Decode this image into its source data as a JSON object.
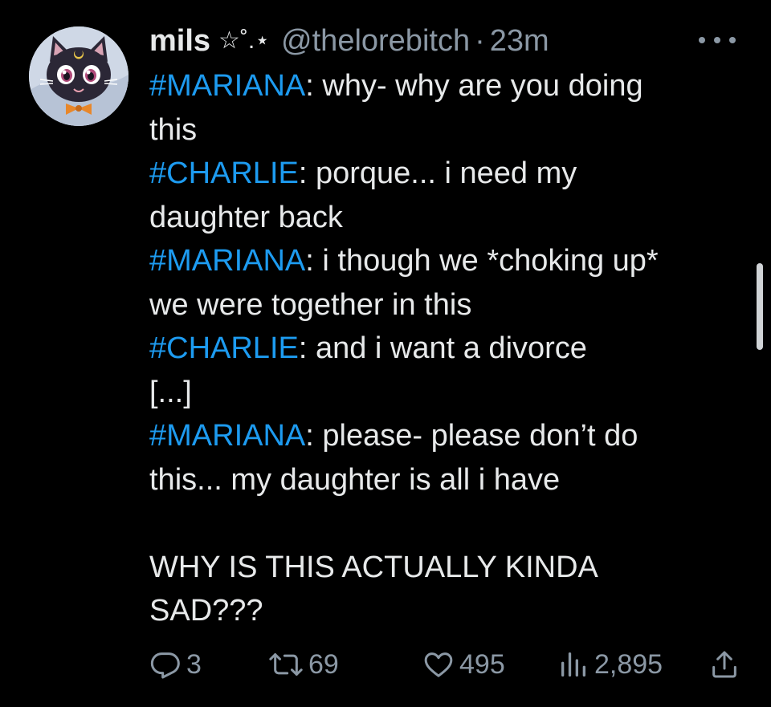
{
  "author": {
    "display_name": "mils",
    "name_decoration": "☆˚.⋆",
    "handle": "@thelorebitch",
    "separator": "·",
    "time": "23m"
  },
  "tweet_lines": [
    {
      "tag": "#MARIANA",
      "text": ": why- why are you doing"
    },
    {
      "tag": "",
      "text": "this"
    },
    {
      "tag": "#CHARLIE",
      "text": ": porque... i need my"
    },
    {
      "tag": "",
      "text": "daughter back"
    },
    {
      "tag": "#MARIANA",
      "text": ": i though we *choking up*"
    },
    {
      "tag": "",
      "text": "we were together in this"
    },
    {
      "tag": "#CHARLIE",
      "text": ": and i want a divorce"
    },
    {
      "tag": "",
      "text": "[...]"
    },
    {
      "tag": "#MARIANA",
      "text": ": please- please don’t do"
    },
    {
      "tag": "",
      "text": "this... my daughter is all i have"
    },
    {
      "tag": "",
      "text": ""
    },
    {
      "tag": "",
      "text": "WHY IS THIS ACTUALLY KINDA"
    },
    {
      "tag": "",
      "text": "SAD???"
    }
  ],
  "actions": {
    "replies": "3",
    "retweets": "69",
    "likes": "495",
    "views": "2,895"
  },
  "icons": {
    "reply": "reply-icon",
    "retweet": "retweet-icon",
    "like": "heart-icon",
    "views": "analytics-icon",
    "share": "share-icon",
    "more": "more-icon"
  },
  "colors": {
    "background": "#000000",
    "text": "#e7e9ea",
    "muted": "#8b98a5",
    "hashtag": "#1d9bf0"
  }
}
